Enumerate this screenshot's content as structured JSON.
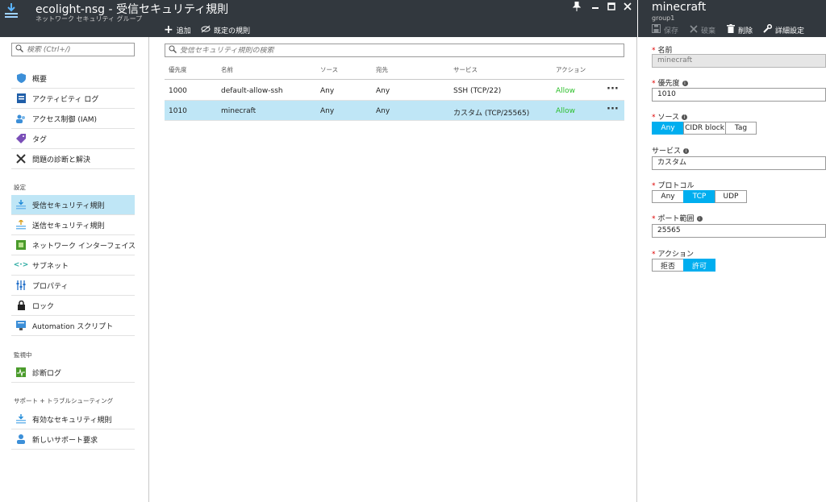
{
  "main": {
    "title": "ecolight-nsg - 受信セキュリティ規則",
    "subtitle": "ネットワーク セキュリティ グループ",
    "toolbar": {
      "add": "追加",
      "default_rules": "既定の規則"
    },
    "window_controls": {
      "pin": "pin-icon",
      "minimize": "minimize-icon",
      "maximize": "maximize-icon",
      "close": "close-icon"
    }
  },
  "sidebar": {
    "search_placeholder": "検索 (Ctrl+/)",
    "top_items": [
      {
        "label": "概要",
        "icon": "shield-icon"
      },
      {
        "label": "アクティビティ ログ",
        "icon": "log-icon"
      },
      {
        "label": "アクセス制御 (IAM)",
        "icon": "users-icon"
      },
      {
        "label": "タグ",
        "icon": "tag-icon"
      },
      {
        "label": "問題の診断と解決",
        "icon": "tools-icon"
      }
    ],
    "section_settings": "設定",
    "settings_items": [
      {
        "label": "受信セキュリティ規則",
        "icon": "inbound-icon"
      },
      {
        "label": "送信セキュリティ規則",
        "icon": "outbound-icon"
      },
      {
        "label": "ネットワーク インターフェイス",
        "icon": "nic-icon"
      },
      {
        "label": "サブネット",
        "icon": "subnet-icon"
      },
      {
        "label": "プロパティ",
        "icon": "properties-icon"
      },
      {
        "label": "ロック",
        "icon": "lock-icon"
      },
      {
        "label": "Automation スクリプト",
        "icon": "script-icon"
      }
    ],
    "section_monitoring": "監視中",
    "monitoring_items": [
      {
        "label": "診断ログ",
        "icon": "diagnostics-icon"
      }
    ],
    "section_support": "サポート + トラブルシューティング",
    "support_items": [
      {
        "label": "有効なセキュリティ規則",
        "icon": "effective-rules-icon"
      },
      {
        "label": "新しいサポート要求",
        "icon": "support-icon"
      }
    ]
  },
  "rules": {
    "search_placeholder": "受信セキュリティ規則の検索",
    "columns": [
      "優先度",
      "名前",
      "ソース",
      "宛先",
      "サービス",
      "アクション"
    ],
    "rows": [
      {
        "priority": "1000",
        "name": "default-allow-ssh",
        "source": "Any",
        "destination": "Any",
        "service": "SSH (TCP/22)",
        "action": "Allow"
      },
      {
        "priority": "1010",
        "name": "minecraft",
        "source": "Any",
        "destination": "Any",
        "service": "カスタム (TCP/25565)",
        "action": "Allow"
      }
    ],
    "more": "···"
  },
  "detail": {
    "title": "minecraft",
    "subtitle": "group1",
    "toolbar": {
      "save": "保存",
      "discard": "破棄",
      "delete": "削除",
      "advanced": "詳細設定"
    },
    "name_label": "名前",
    "name_value": "minecraft",
    "priority_label": "優先度",
    "priority_value": "1010",
    "source_label": "ソース",
    "source_options": [
      "Any",
      "CIDR block",
      "Tag"
    ],
    "source_selected": "Any",
    "service_label": "サービス",
    "service_value": "カスタム",
    "protocol_label": "プロトコル",
    "protocol_options": [
      "Any",
      "TCP",
      "UDP"
    ],
    "protocol_selected": "TCP",
    "port_label": "ポート範囲",
    "port_value": "25565",
    "action_label": "アクション",
    "action_options": [
      "拒否",
      "許可"
    ],
    "action_selected": "許可",
    "required_mark": "*",
    "info_mark": "i"
  },
  "colors": {
    "header_bg": "#32383e",
    "selected_row": "#bfe6f6",
    "toggle_on": "#00aeef",
    "allow_text": "#2cbf2c"
  }
}
